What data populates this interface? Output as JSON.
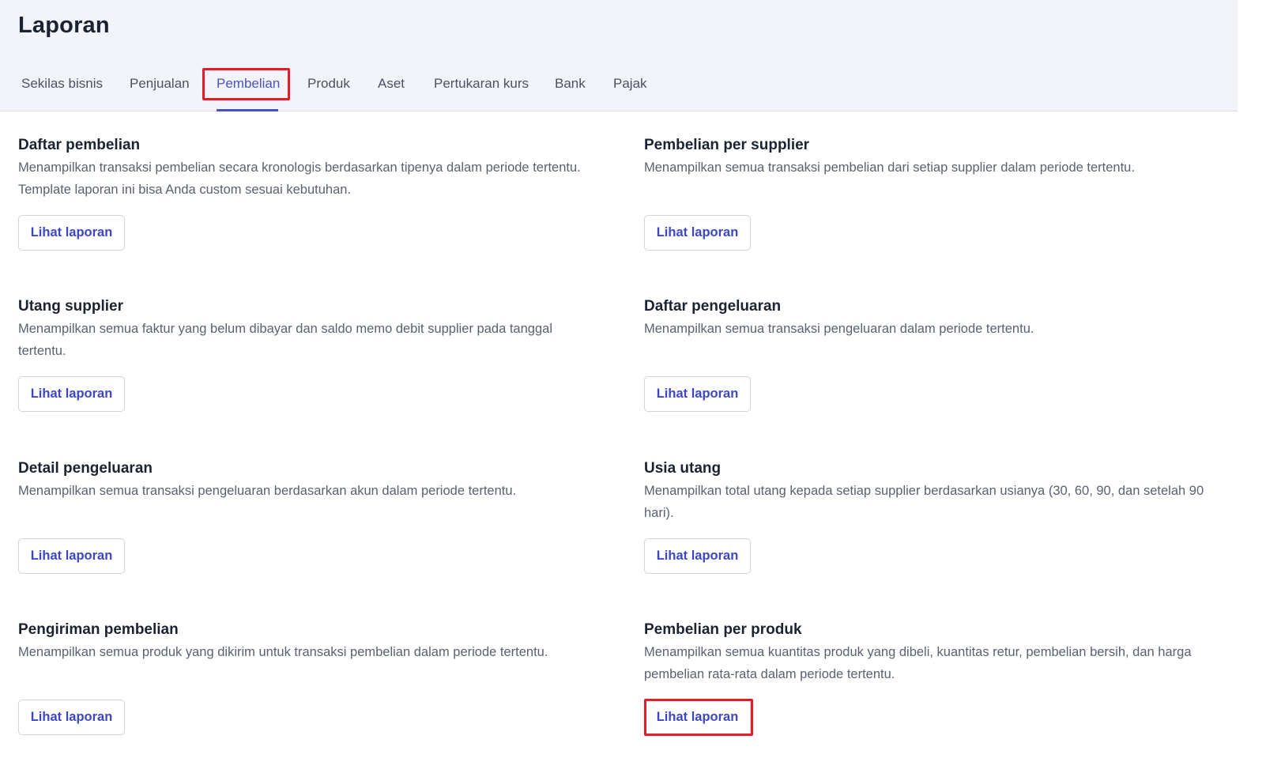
{
  "header": {
    "title": "Laporan"
  },
  "tabs": [
    {
      "label": "Sekilas bisnis"
    },
    {
      "label": "Penjualan"
    },
    {
      "label": "Pembelian"
    },
    {
      "label": "Produk"
    },
    {
      "label": "Aset"
    },
    {
      "label": "Pertukaran kurs"
    },
    {
      "label": "Bank"
    },
    {
      "label": "Pajak"
    }
  ],
  "active_tab": "Pembelian",
  "reports": [
    {
      "title": "Daftar pembelian",
      "description": "Menampilkan transaksi pembelian secara kronologis berdasarkan tipenya dalam periode tertentu. Template laporan ini bisa Anda custom sesuai kebutuhan.",
      "button": "Lihat laporan"
    },
    {
      "title": "Pembelian per supplier",
      "description": "Menampilkan semua transaksi pembelian dari setiap supplier dalam periode tertentu.",
      "button": "Lihat laporan"
    },
    {
      "title": "Utang supplier",
      "description": "Menampilkan semua faktur yang belum dibayar dan saldo memo debit supplier pada tanggal tertentu.",
      "button": "Lihat laporan"
    },
    {
      "title": "Daftar pengeluaran",
      "description": "Menampilkan semua transaksi pengeluaran dalam periode tertentu.",
      "button": "Lihat laporan"
    },
    {
      "title": "Detail pengeluaran",
      "description": "Menampilkan semua transaksi pengeluaran berdasarkan akun dalam periode tertentu.",
      "button": "Lihat laporan"
    },
    {
      "title": "Usia utang",
      "description": "Menampilkan total utang kepada setiap supplier berdasarkan usianya (30, 60, 90, dan setelah 90 hari).",
      "button": "Lihat laporan"
    },
    {
      "title": "Pengiriman pembelian",
      "description": "Menampilkan semua produk yang dikirim untuk transaksi pembelian dalam periode tertentu.",
      "button": "Lihat laporan"
    },
    {
      "title": "Pembelian per produk",
      "description": "Menampilkan semua kuantitas produk yang dibeli, kuantitas retur, pembelian bersih, dan harga pembelian rata-rata dalam periode tertentu.",
      "button": "Lihat laporan"
    }
  ],
  "colors": {
    "accent": "#4a52c8",
    "highlight": "#e01e2a",
    "header_bg": "#f2f4f9"
  }
}
